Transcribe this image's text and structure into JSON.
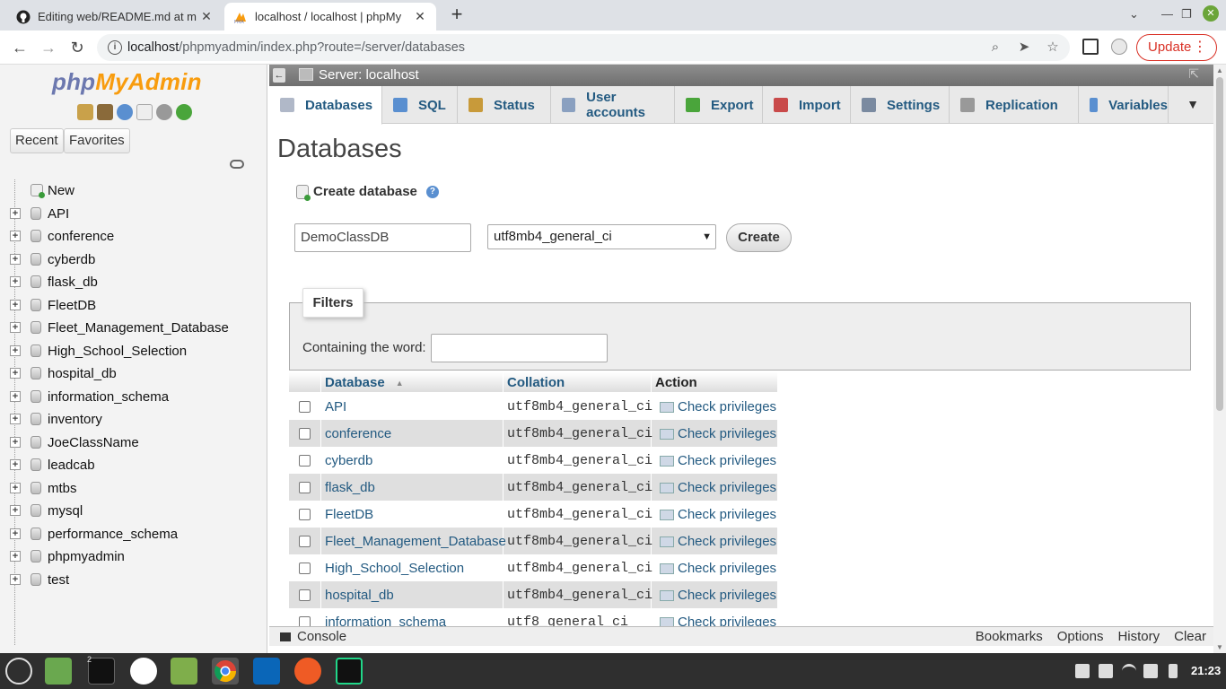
{
  "browser": {
    "tabs": [
      {
        "title": "Editing web/README.md at m",
        "active": false
      },
      {
        "title": "localhost / localhost | phpMy",
        "active": true
      }
    ],
    "new_tab_symbol": "+",
    "url_host": "localhost",
    "url_path": "/phpmyadmin/index.php?route=/server/databases",
    "update_label": "Update"
  },
  "pma": {
    "logo_php": "php",
    "logo_myadmin": "MyAdmin",
    "recent_label": "Recent",
    "favorites_label": "Favorites",
    "tree_new": "New",
    "tree": [
      "API",
      "conference",
      "cyberdb",
      "flask_db",
      "FleetDB",
      "Fleet_Management_Database",
      "High_School_Selection",
      "hospital_db",
      "information_schema",
      "inventory",
      "JoeClassName",
      "leadcab",
      "mtbs",
      "mysql",
      "performance_schema",
      "phpmyadmin",
      "test"
    ],
    "server_label": "Server: localhost",
    "menu": [
      {
        "label": "Databases",
        "icon": "database-icon",
        "active": true
      },
      {
        "label": "SQL",
        "icon": "sql-icon"
      },
      {
        "label": "Status",
        "icon": "status-icon"
      },
      {
        "label": "User accounts",
        "icon": "users-icon"
      },
      {
        "label": "Export",
        "icon": "export-icon"
      },
      {
        "label": "Import",
        "icon": "import-icon"
      },
      {
        "label": "Settings",
        "icon": "wrench-icon"
      },
      {
        "label": "Replication",
        "icon": "replication-icon"
      },
      {
        "label": "Variables",
        "icon": "variables-icon"
      }
    ],
    "page_title": "Databases",
    "create_db_label": "Create database",
    "db_name_value": "DemoClassDB",
    "collation_value": "utf8mb4_general_ci",
    "create_button": "Create",
    "filters_legend": "Filters",
    "containing_label": "Containing the word:",
    "containing_value": "",
    "table": {
      "headers": {
        "database": "Database",
        "collation": "Collation",
        "action": "Action"
      },
      "rows": [
        {
          "name": "API",
          "collation": "utf8mb4_general_ci",
          "action": "Check privileges"
        },
        {
          "name": "conference",
          "collation": "utf8mb4_general_ci",
          "action": "Check privileges"
        },
        {
          "name": "cyberdb",
          "collation": "utf8mb4_general_ci",
          "action": "Check privileges"
        },
        {
          "name": "flask_db",
          "collation": "utf8mb4_general_ci",
          "action": "Check privileges"
        },
        {
          "name": "FleetDB",
          "collation": "utf8mb4_general_ci",
          "action": "Check privileges"
        },
        {
          "name": "Fleet_Management_Database",
          "collation": "utf8mb4_general_ci",
          "action": "Check privileges"
        },
        {
          "name": "High_School_Selection",
          "collation": "utf8mb4_general_ci",
          "action": "Check privileges"
        },
        {
          "name": "hospital_db",
          "collation": "utf8mb4_general_ci",
          "action": "Check privileges"
        },
        {
          "name": "information_schema",
          "collation": "utf8_general_ci",
          "action": "Check privileges"
        }
      ]
    },
    "console_label": "Console",
    "console_links": [
      "Bookmarks",
      "Options",
      "History",
      "Clear"
    ]
  },
  "taskbar": {
    "terminal_badge": "2",
    "clock": "21:23"
  },
  "colors": {
    "pma_link": "#235a81",
    "update_red": "#d93025",
    "logo_blue": "#6c78af",
    "logo_orange": "#f89c0e"
  }
}
